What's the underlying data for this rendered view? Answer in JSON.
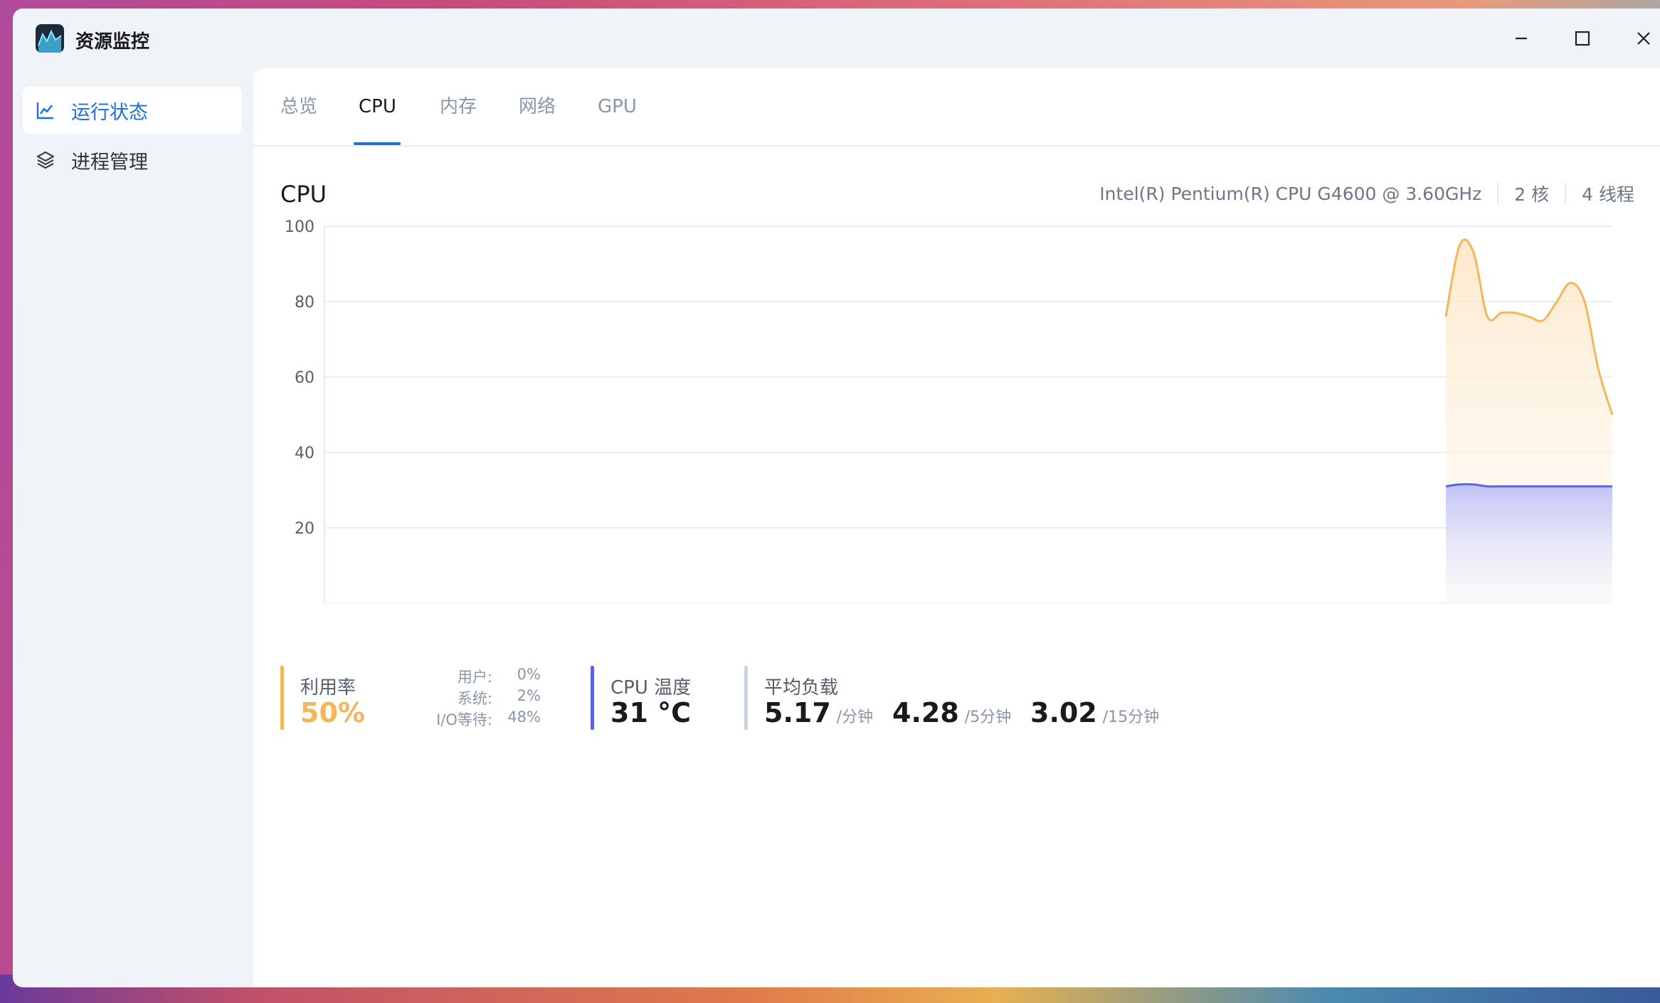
{
  "app": {
    "title": "资源监控",
    "icon": "activity-chart-icon"
  },
  "window_controls": {
    "minimize": "minimize-icon",
    "maximize": "maximize-icon",
    "close": "close-icon"
  },
  "sidebar": {
    "items": [
      {
        "label": "运行状态",
        "icon": "line-chart-icon",
        "active": true
      },
      {
        "label": "进程管理",
        "icon": "layers-icon",
        "active": false
      }
    ]
  },
  "tabs": [
    {
      "label": "总览",
      "active": false
    },
    {
      "label": "CPU",
      "active": true
    },
    {
      "label": "内存",
      "active": false
    },
    {
      "label": "网络",
      "active": false
    },
    {
      "label": "GPU",
      "active": false
    }
  ],
  "cpu": {
    "title": "CPU",
    "model": "Intel(R) Pentium(R) CPU G4600 @ 3.60GHz",
    "cores": "2 核",
    "threads": "4 线程"
  },
  "chart_data": {
    "type": "area",
    "ylim": [
      0,
      100
    ],
    "y_ticks": [
      "100",
      "80",
      "60",
      "40",
      "20"
    ],
    "grid": true,
    "colors": {
      "usage": "#f4b65a",
      "temperature": "#5b64e8"
    },
    "series": [
      {
        "x": [
          0.0,
          0.5,
          1.0,
          1.5,
          2.0,
          2.5,
          3.0,
          3.5,
          4.0,
          4.5,
          5.0,
          5.5,
          6.0
        ],
        "values": [
          76,
          95,
          93,
          76,
          77,
          77,
          76,
          75,
          80,
          85,
          80,
          62,
          50
        ]
      },
      {
        "x": [
          0.0,
          0.5,
          1.0,
          1.5,
          2.0,
          2.5,
          3.0,
          3.5,
          4.0,
          4.5,
          5.0,
          5.5,
          6.0
        ],
        "values": [
          31,
          31.5,
          31.5,
          31,
          31,
          31,
          31,
          31,
          31,
          31,
          31,
          31,
          31
        ]
      }
    ]
  },
  "stats": {
    "usage": {
      "label": "利用率",
      "value": "50%",
      "color": "#f4b65a"
    },
    "breakdown": [
      {
        "label": "用户:",
        "value": "0%"
      },
      {
        "label": "系统:",
        "value": "2%"
      },
      {
        "label": "I/O等待:",
        "value": "48%"
      }
    ],
    "temperature": {
      "label": "CPU 温度",
      "value": "31 °C",
      "color": "#5b64e8"
    },
    "load": {
      "label": "平均负载",
      "color": "#c8d2e0",
      "items": [
        {
          "value": "5.17",
          "unit": "/分钟"
        },
        {
          "value": "4.28",
          "unit": "/5分钟"
        },
        {
          "value": "3.02",
          "unit": "/15分钟"
        }
      ]
    }
  }
}
